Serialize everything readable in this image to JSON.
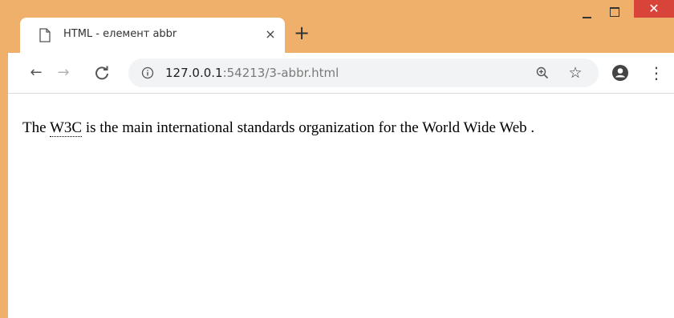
{
  "tab": {
    "title": "HTML - елемент abbr",
    "close_glyph": "×"
  },
  "new_tab_glyph": "+",
  "window_controls": {
    "close_glyph": "✕"
  },
  "toolbar": {
    "back_glyph": "←",
    "forward_glyph": "→",
    "reload_glyph": "C",
    "star_glyph": "☆",
    "menu_glyph": "⋮"
  },
  "address_bar": {
    "host": "127.0.0.1",
    "rest": ":54213/3-abbr.html"
  },
  "page": {
    "before": "The ",
    "abbr": "W3C",
    "after": " is the main international standards organization for the World Wide Web ."
  },
  "colors": {
    "frame": "#eeb06a",
    "close_button": "#d9443a"
  }
}
